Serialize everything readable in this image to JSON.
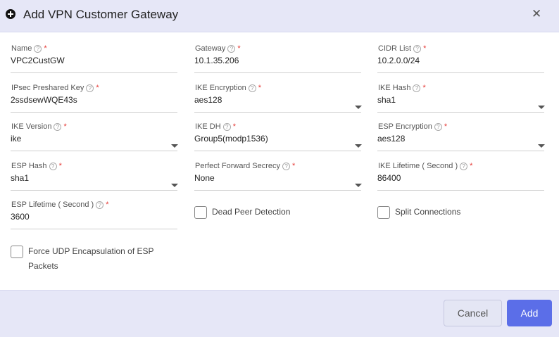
{
  "dialog": {
    "title": "Add VPN Customer Gateway",
    "close_symbol": "✕"
  },
  "fields": {
    "name": {
      "label": "Name",
      "value": "VPC2CustGW",
      "required": "*"
    },
    "gateway": {
      "label": "Gateway",
      "value": "10.1.35.206",
      "required": "*"
    },
    "cidr": {
      "label": "CIDR List",
      "value": "10.2.0.0/24",
      "required": "*"
    },
    "ipsec": {
      "label": "IPsec Preshared Key",
      "value": "2ssdsewWQE43s",
      "required": "*"
    },
    "ike_encryption": {
      "label": "IKE Encryption",
      "value": "aes128",
      "required": "*"
    },
    "ike_hash": {
      "label": "IKE Hash",
      "value": "sha1",
      "required": "*"
    },
    "ike_version": {
      "label": "IKE Version",
      "value": "ike",
      "required": "*"
    },
    "ike_dh": {
      "label": "IKE DH",
      "value": "Group5(modp1536)",
      "required": "*"
    },
    "esp_encryption": {
      "label": "ESP Encryption",
      "value": "aes128",
      "required": "*"
    },
    "esp_hash": {
      "label": "ESP Hash",
      "value": "sha1",
      "required": "*"
    },
    "pfs": {
      "label": "Perfect Forward Secrecy",
      "value": "None",
      "required": "*"
    },
    "ike_lifetime": {
      "label": "IKE Lifetime ( Second )",
      "value": "86400",
      "required": "*"
    },
    "esp_lifetime": {
      "label": "ESP Lifetime ( Second )",
      "value": "3600",
      "required": "*"
    }
  },
  "checkboxes": {
    "dead_peer": "Dead Peer Detection",
    "split": "Split Connections",
    "force_udp_line1": "Force UDP Encapsulation of ESP",
    "force_udp_line2": "Packets"
  },
  "help_symbol": "?",
  "footer": {
    "cancel_label": "Cancel",
    "add_label": "Add"
  }
}
